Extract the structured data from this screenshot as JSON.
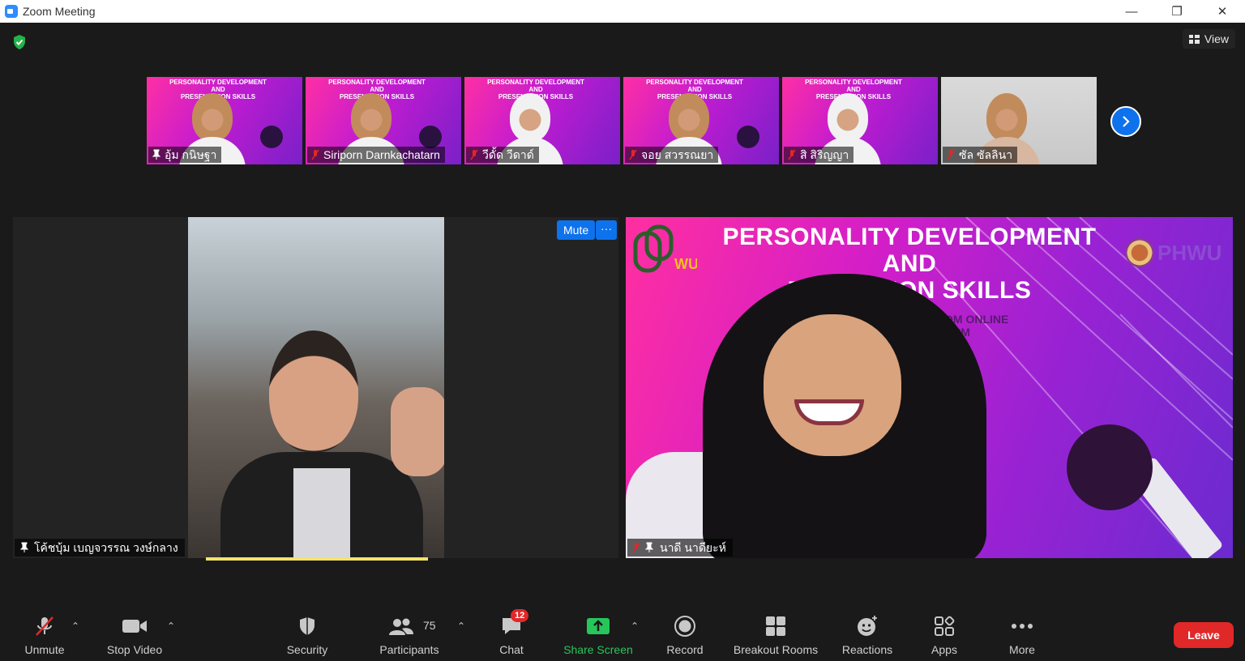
{
  "window": {
    "title": "Zoom Meeting"
  },
  "header": {
    "view_label": "View"
  },
  "thumbnail_slide": {
    "line1": "PERSONALITY DEVELOPMENT",
    "line2": "AND",
    "line3": "PRESENTATION SKILLS"
  },
  "participants_strip": [
    {
      "name": "อุ้ม กนิษฐา",
      "style": "pink",
      "pinned": true,
      "muted": false
    },
    {
      "name": "Siriporn Darnkachatarn",
      "style": "pink",
      "pinned": false,
      "muted": true
    },
    {
      "name": "วีดั้ด วีดาด์",
      "style": "hijab",
      "pinned": false,
      "muted": true
    },
    {
      "name": "จอย สวรรณยา",
      "style": "pink",
      "pinned": false,
      "muted": true
    },
    {
      "name": "สิ สิริญญา",
      "style": "hijab",
      "pinned": false,
      "muted": true
    },
    {
      "name": "ซัล ซัลลินา",
      "style": "plain",
      "pinned": false,
      "muted": true
    }
  ],
  "main_left": {
    "name": "โค้ชบุ้ม เบญจวรรณ วงษ์กลาง",
    "mute_label": "Mute",
    "more_label": "···"
  },
  "main_right": {
    "name": "นาดี นาดียะห์",
    "slide_title_1": "PERSONALITY DEVELOPMENT",
    "slide_title_2": "AND",
    "slide_title_3": "PRE      TATION SKILLS",
    "slide_sub_1": "2022 · ZOOM ONLINE",
    "slide_sub_2": "AM - 04:00 PM",
    "logo_text": "PHWU",
    "logo_left_text": "WU"
  },
  "toolbar": {
    "unmute": "Unmute",
    "stop_video": "Stop Video",
    "security": "Security",
    "participants": "Participants",
    "participants_count": "75",
    "chat": "Chat",
    "chat_badge": "12",
    "share_screen": "Share Screen",
    "record": "Record",
    "breakout_rooms": "Breakout Rooms",
    "reactions": "Reactions",
    "apps": "Apps",
    "more": "More",
    "leave": "Leave"
  },
  "colors": {
    "accent": "#0e72ed",
    "leave": "#e02828",
    "share": "#27c65a",
    "speaker_bar": "#f3e36a"
  }
}
